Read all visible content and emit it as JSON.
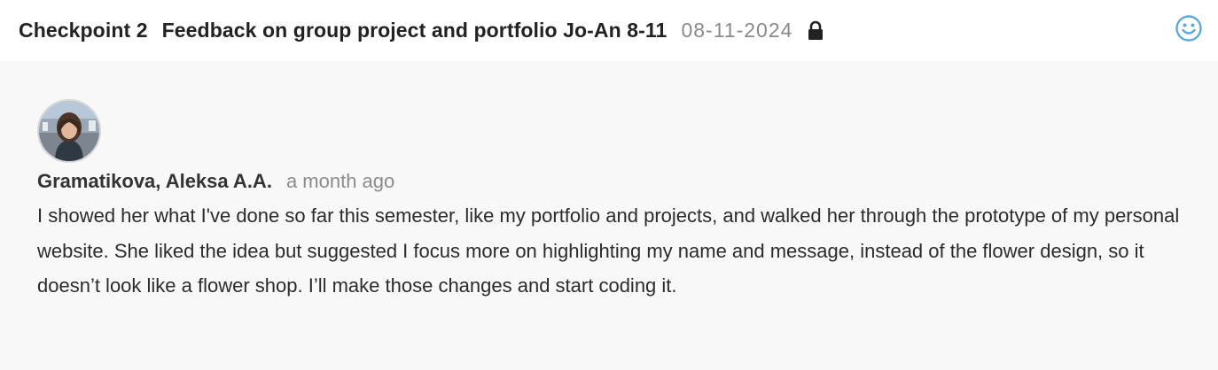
{
  "header": {
    "checkpoint": "Checkpoint 2",
    "title": "Feedback on group project and portfolio Jo-An 8-11",
    "date": "08-11-2024",
    "lock_icon": "lock-icon",
    "reaction_icon": "smiley-icon",
    "reaction_color": "#5aaae0"
  },
  "comment": {
    "author": "Gramatikova, Aleksa A.A.",
    "time": "a month ago",
    "text": "I showed her what I've done so far this semester, like my portfolio and projects, and walked her through the prototype of my personal website. She liked the idea but suggested I focus more on highlighting my name and message, instead of the flower design, so it doesn’t look like a flower shop. I’ll make those changes and start coding it."
  }
}
